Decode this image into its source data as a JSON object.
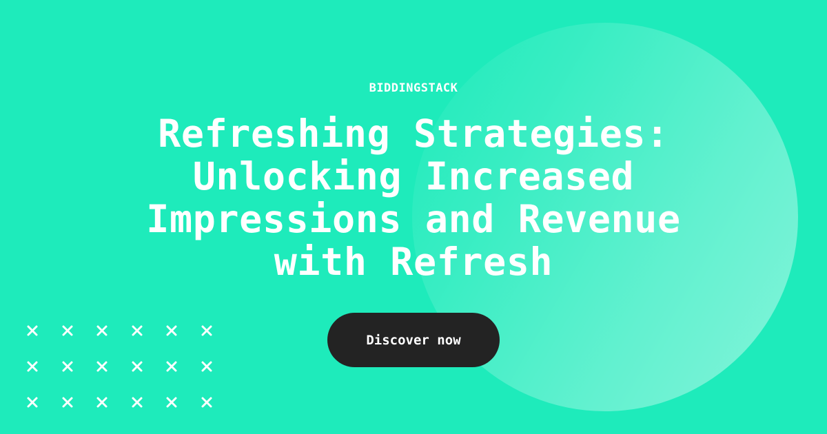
{
  "brand": {
    "name": "BIDDINGSTACK"
  },
  "headline": {
    "lines": [
      "Refreshing Strategies:",
      "Unlocking Increased",
      "Impressions and Revenue",
      "with Refresh"
    ]
  },
  "cta": {
    "label": "Discover now"
  },
  "decoration": {
    "pattern_icon": "x-mark-icon",
    "rows": 3,
    "columns": 6
  },
  "colors": {
    "background": "#1eebbb",
    "button": "#232323",
    "text": "#ffffff"
  }
}
